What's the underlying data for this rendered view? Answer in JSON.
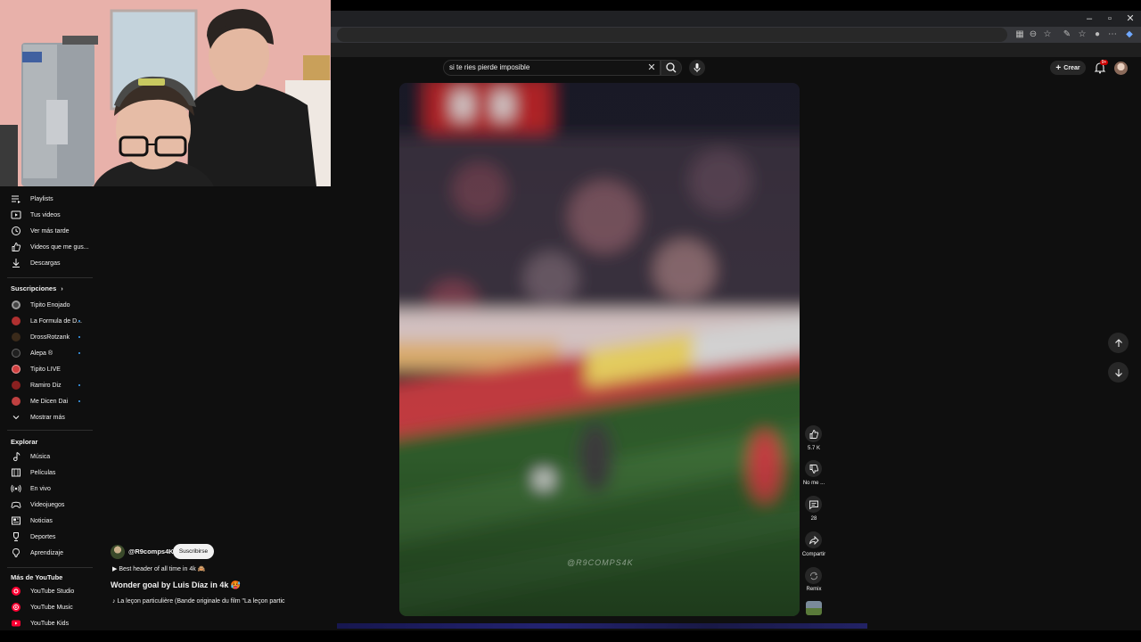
{
  "browser": {
    "window_controls": {
      "minimize": "–",
      "maximize": "▫",
      "close": "✕"
    }
  },
  "header": {
    "search_value": "si te ries pierde imposible",
    "create_label": "Crear",
    "notification_badge": "9+"
  },
  "sidebar": {
    "you_items": [
      {
        "label": "Playlists",
        "icon": "playlist-icon"
      },
      {
        "label": "Tus videos",
        "icon": "video-icon"
      },
      {
        "label": "Ver más tarde",
        "icon": "clock-icon"
      },
      {
        "label": "Videos que me gus...",
        "icon": "thumbs-up-icon"
      },
      {
        "label": "Descargas",
        "icon": "download-icon"
      }
    ],
    "subscriptions_title": "Suscripciones",
    "subscriptions": [
      {
        "label": "Tipito Enojado",
        "color": "#444444",
        "new": false
      },
      {
        "label": "La Formula de D...",
        "color": "#b03030",
        "new": true
      },
      {
        "label": "DrossRotzank",
        "color": "#3a2a1a",
        "new": true
      },
      {
        "label": "Alepa ®",
        "color": "#202020",
        "new": true
      },
      {
        "label": "Tipito LIVE",
        "color": "#d04040",
        "new": false
      },
      {
        "label": "Ramiro Diz",
        "color": "#8a2020",
        "new": true
      },
      {
        "label": "Me Dicen Dai",
        "color": "#c04040",
        "new": true
      }
    ],
    "show_more": "Mostrar más",
    "explore_title": "Explorar",
    "explore": [
      {
        "label": "Música",
        "icon": "music-note-icon"
      },
      {
        "label": "Películas",
        "icon": "film-icon"
      },
      {
        "label": "En vivo",
        "icon": "live-icon"
      },
      {
        "label": "Videojuegos",
        "icon": "gamepad-icon"
      },
      {
        "label": "Noticias",
        "icon": "news-icon"
      },
      {
        "label": "Deportes",
        "icon": "trophy-icon"
      },
      {
        "label": "Aprendizaje",
        "icon": "lightbulb-icon"
      }
    ],
    "more_title": "Más de YouTube",
    "more": [
      {
        "label": "YouTube Studio"
      },
      {
        "label": "YouTube Music"
      },
      {
        "label": "YouTube Kids"
      }
    ]
  },
  "video": {
    "watermark": "@R9COMPS4K",
    "channel": "@R9comps4K",
    "subscribe_label": "Suscribirse",
    "description": "▶ Best header of all time in 4k 🙈",
    "title": "Wonder goal by Luis Díaz in 4k 🥵",
    "music": "♪ La leçon particulière (Bande originale du film \"La leçon partic"
  },
  "actions": {
    "like_count": "5.7 K",
    "dislike_label": "No me ...",
    "comments_count": "28",
    "share_label": "Compartir",
    "remix_label": "Remix"
  },
  "colors": {
    "background": "#0f0f0f",
    "accent_red": "#ff0033",
    "button_bg": "#272727"
  }
}
